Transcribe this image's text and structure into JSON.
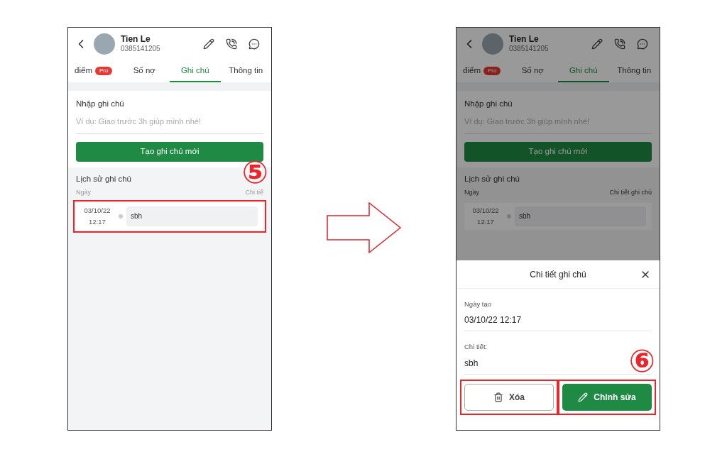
{
  "screens": [
    {
      "contact": {
        "name": "Tien Le",
        "phone": "0385141205"
      },
      "tabs": [
        {
          "label": "điểm",
          "badge": "Pro",
          "selected": false
        },
        {
          "label": "Số nợ",
          "selected": false
        },
        {
          "label": "Ghi chú",
          "selected": true
        },
        {
          "label": "Thông tin",
          "selected": false
        }
      ],
      "note_form": {
        "label": "Nhập ghi chú",
        "placeholder": "Ví dụ: Giao trước 3h giúp mình nhé!",
        "button": "Tạo ghi chú mới"
      },
      "history": {
        "title": "Lịch sử ghi chú",
        "columns": [
          "Ngày",
          "Chi tiế"
        ],
        "rows": [
          {
            "date": "03/10/22",
            "time": "12:17",
            "detail": "sbh",
            "highlighted": true
          }
        ]
      },
      "dimmed": false,
      "step_marker": "⑤"
    },
    {
      "contact": {
        "name": "Tien Le",
        "phone": "0385141205"
      },
      "tabs": [
        {
          "label": "điểm",
          "badge": "Pro",
          "selected": false
        },
        {
          "label": "Số nợ",
          "selected": false
        },
        {
          "label": "Ghi chú",
          "selected": true
        },
        {
          "label": "Thông tin",
          "selected": false
        }
      ],
      "note_form": {
        "label": "Nhập ghi chú",
        "placeholder": "Ví dụ: Giao trước 3h giúp mình nhé!",
        "button": "Tạo ghi chú mới"
      },
      "history": {
        "title": "Lịch sử ghi chú",
        "columns": [
          "Ngày",
          "Chi tiết ghi chú"
        ],
        "rows": [
          {
            "date": "03/10/22",
            "time": "12:17",
            "detail": "sbh",
            "highlighted": false
          }
        ]
      },
      "dimmed": true,
      "step_marker": "⑥",
      "sheet": {
        "title": "Chi tiết ghi chú",
        "fields": [
          {
            "label": "Ngày tạo",
            "value": "03/10/22 12:17"
          },
          {
            "label": "Chi tiết:",
            "value": "sbh"
          }
        ],
        "buttons": [
          {
            "kind": "delete",
            "label": "Xóa",
            "highlighted": true
          },
          {
            "kind": "edit",
            "label": "Chỉnh sửa",
            "highlighted": true
          }
        ]
      }
    }
  ]
}
